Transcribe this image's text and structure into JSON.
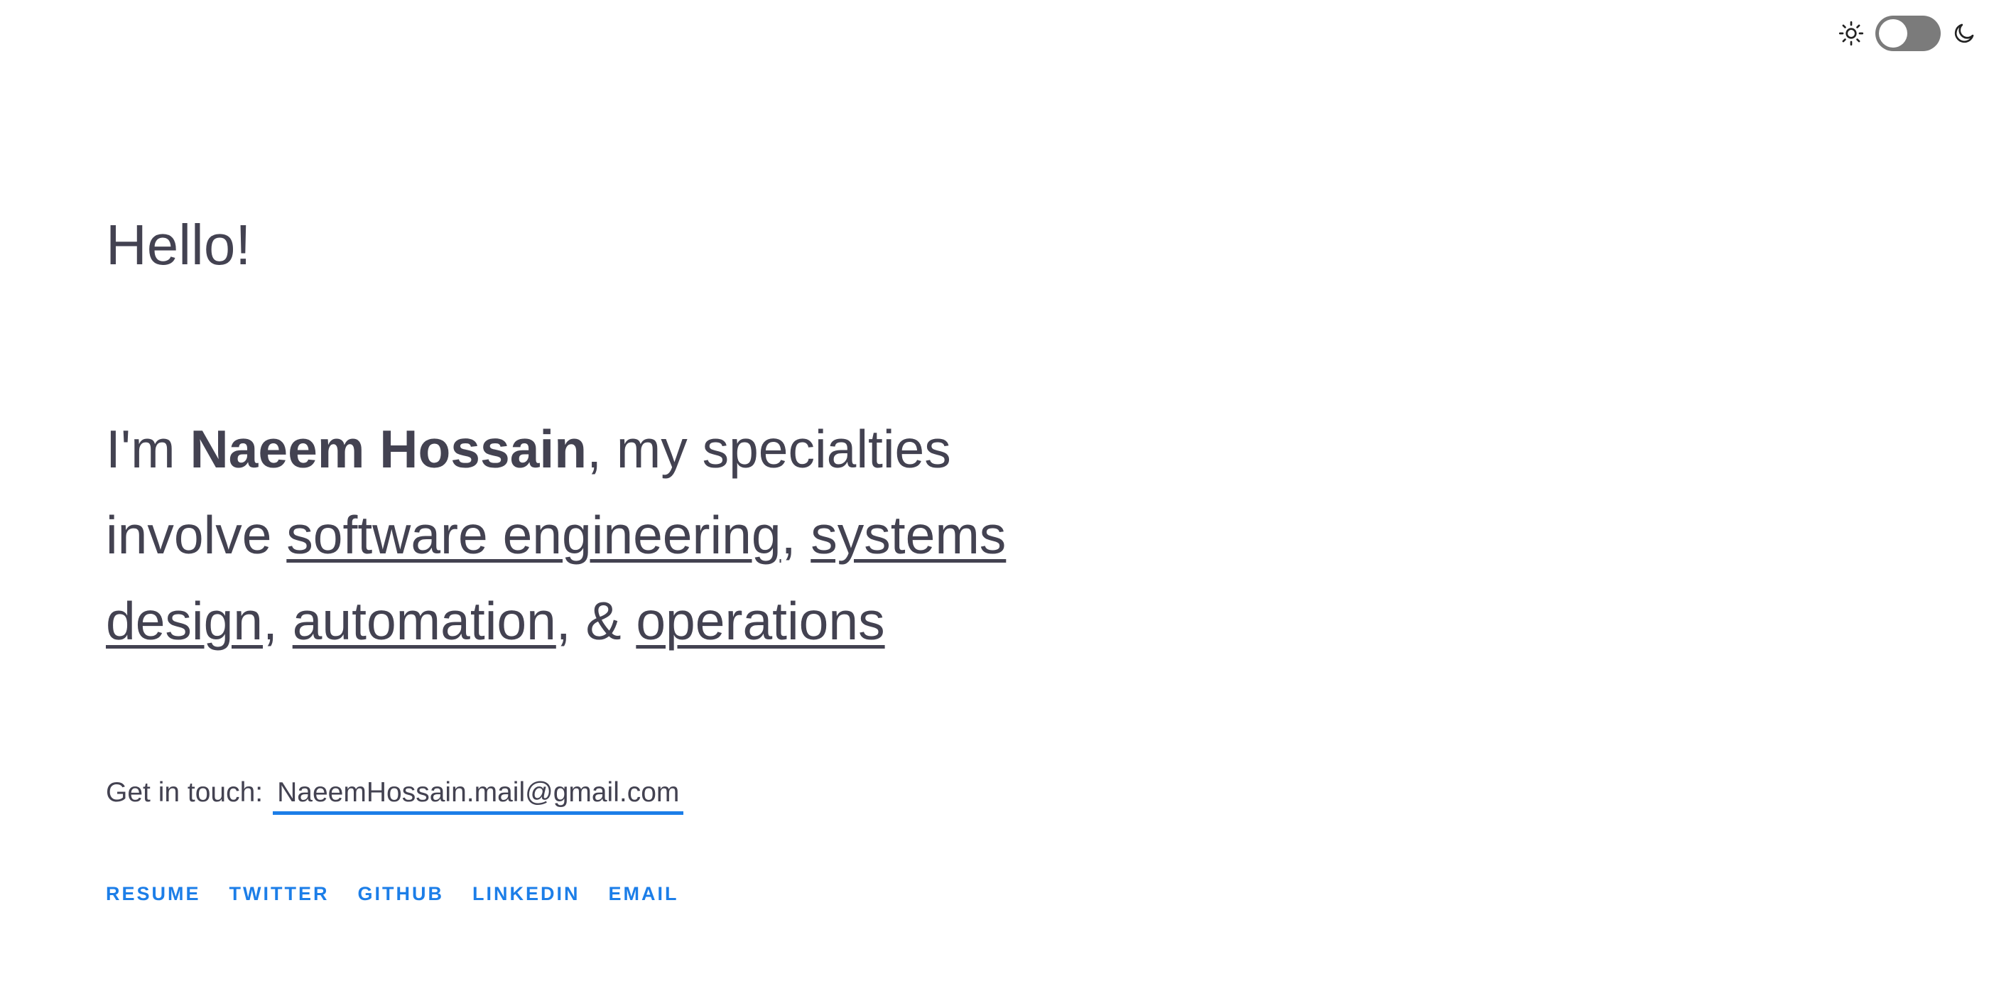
{
  "theme_toggle": {
    "light_icon": "sun-icon",
    "dark_icon": "moon-icon",
    "state": "light"
  },
  "hero": {
    "greeting": "Hello!",
    "intro_prefix": "I'm ",
    "name": "Naeem Hossain",
    "intro_middle": ", my specialties",
    "line2_prefix": "involve ",
    "specialty_1": "software engineering",
    "sep_1": ", ",
    "specialty_2_part1": "systems",
    "specialty_2_part2": "design",
    "sep_2": ", ",
    "specialty_3": "automation",
    "sep_3": ", & ",
    "specialty_4": "operations"
  },
  "contact": {
    "label": "Get in touch:",
    "email": "NaeemHossain.mail@gmail.com"
  },
  "social_links": [
    "RESUME",
    "TWITTER",
    "GITHUB",
    "LINKEDIN",
    "EMAIL"
  ],
  "colors": {
    "text": "#434251",
    "accent": "#1c7ee8",
    "toggle_track": "#7b7b7b",
    "background": "#ffffff"
  }
}
